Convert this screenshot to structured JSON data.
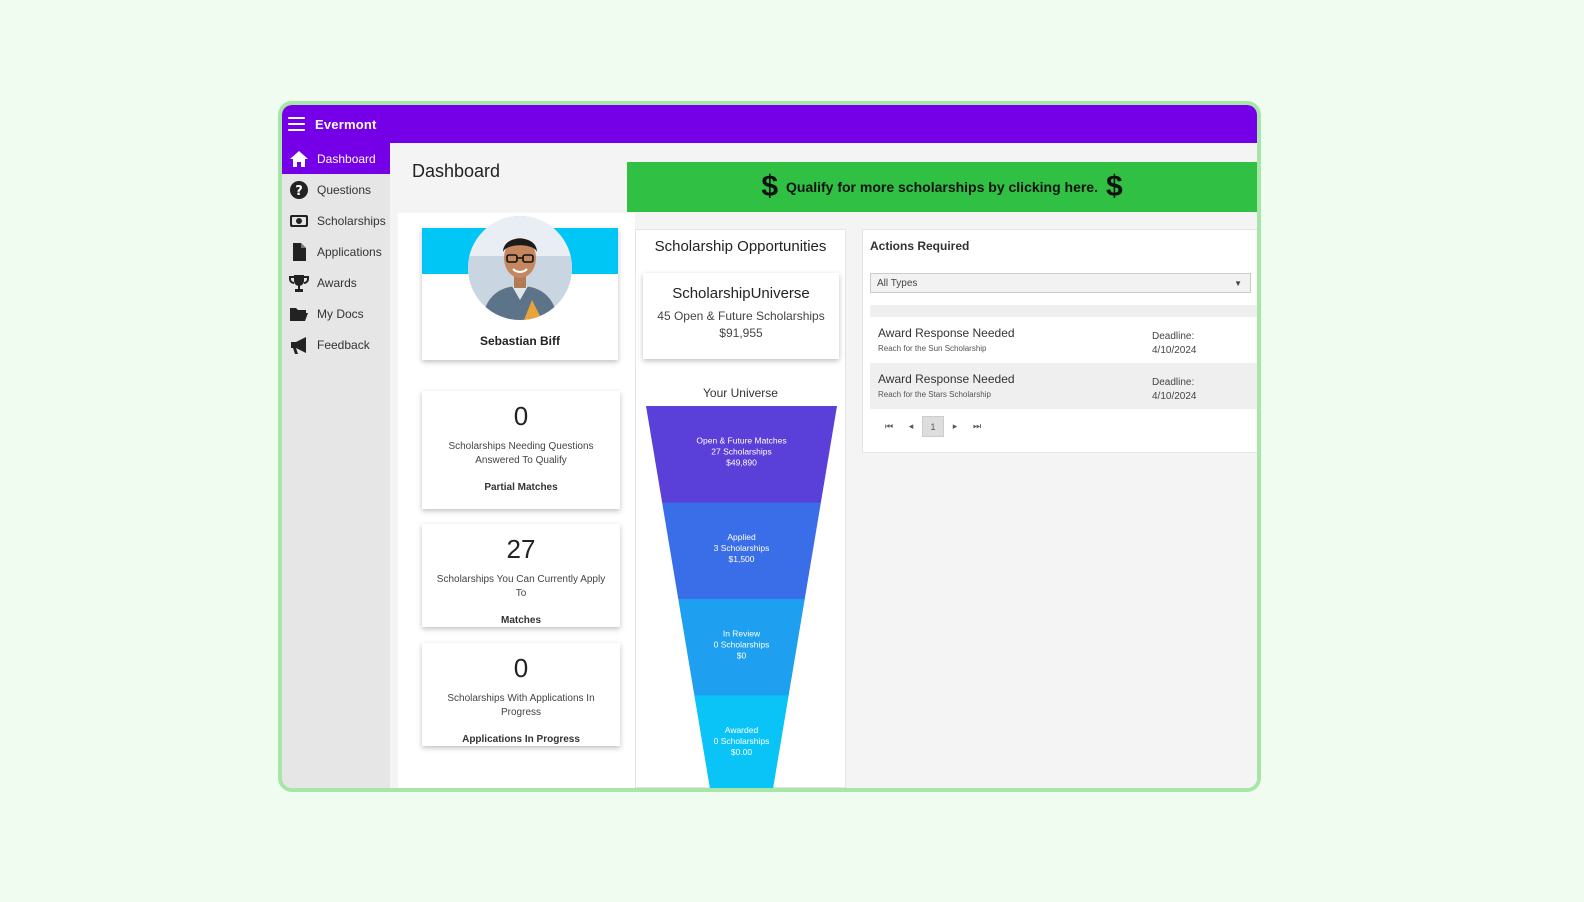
{
  "app": {
    "title": "Evermont"
  },
  "sidebar": {
    "items": [
      {
        "label": "Dashboard",
        "icon": "home-icon"
      },
      {
        "label": "Questions",
        "icon": "question-icon"
      },
      {
        "label": "Scholarships",
        "icon": "money-icon"
      },
      {
        "label": "Applications",
        "icon": "document-icon"
      },
      {
        "label": "Awards",
        "icon": "trophy-icon"
      },
      {
        "label": "My Docs",
        "icon": "folder-icon"
      },
      {
        "label": "Feedback",
        "icon": "megaphone-icon"
      }
    ],
    "active": "Dashboard"
  },
  "page": {
    "title": "Dashboard"
  },
  "banner": {
    "symbol": "$",
    "text": "Qualify for more scholarships by clicking here."
  },
  "profile": {
    "name": "Sebastian Biff"
  },
  "stats": [
    {
      "value": "0",
      "description": "Scholarships Needing Questions Answered To Qualify",
      "label": "Partial Matches"
    },
    {
      "value": "27",
      "description": "Scholarships You Can Currently Apply To",
      "label": "Matches"
    },
    {
      "value": "0",
      "description": "Scholarships With Applications In Progress",
      "label": "Applications In Progress"
    }
  ],
  "opportunities": {
    "title": "Scholarship Opportunities",
    "universe": {
      "title": "ScholarshipUniverse",
      "subtitle": "45 Open & Future Scholarships",
      "value": "$91,955"
    },
    "your_universe_label": "Your Universe",
    "funnel": [
      {
        "stage": "Open & Future Matches",
        "count": "27 Scholarships",
        "amount": "$49,890",
        "color": "#5a3fd8"
      },
      {
        "stage": "Applied",
        "count": "3 Scholarships",
        "amount": "$1,500",
        "color": "#3a6ee8"
      },
      {
        "stage": "In Review",
        "count": "0 Scholarships",
        "amount": "$0",
        "color": "#1e9ff0"
      },
      {
        "stage": "Awarded",
        "count": "0 Scholarships",
        "amount": "$0.00",
        "color": "#0ac4f8"
      }
    ]
  },
  "actions": {
    "title": "Actions Required",
    "filter": {
      "selected": "All Types"
    },
    "items": [
      {
        "title": "Award Response Needed",
        "subtitle": "Reach for the Sun Scholarship",
        "deadline_label": "Deadline:",
        "deadline": "4/10/2024"
      },
      {
        "title": "Award Response Needed",
        "subtitle": "Reach for the Stars Scholarship",
        "deadline_label": "Deadline:",
        "deadline": "4/10/2024"
      }
    ],
    "pager": {
      "first": "⏮",
      "prev": "◂",
      "current": "1",
      "next": "▸",
      "last": "⏭"
    }
  },
  "colors": {
    "header": "#7500e8",
    "banner": "#30c043",
    "profile_cover": "#00c6f5",
    "frame": "#a6e6a6"
  }
}
